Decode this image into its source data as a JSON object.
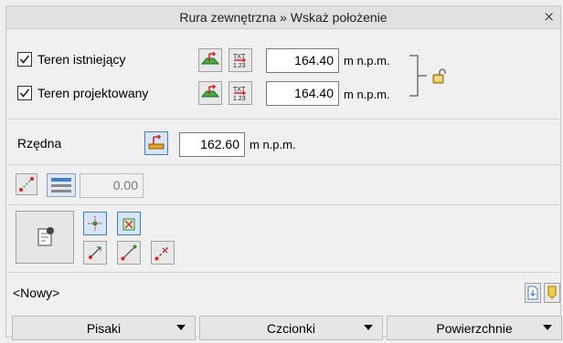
{
  "window": {
    "title": "Rura zewnętrzna » Wskaż położenie",
    "close_glyph": "×"
  },
  "terrain": {
    "existing": {
      "label": "Teren istniejący",
      "checked": true,
      "value": "164.40",
      "unit": "m n.p.m."
    },
    "designed": {
      "label": "Teren projektowany",
      "checked": true,
      "value": "164.40",
      "unit": "m n.p.m."
    },
    "txt_icon_top": "TXT",
    "txt_icon_bottom": "1.23"
  },
  "ordinate": {
    "label": "Rzędna",
    "value": "162.60",
    "unit": "m n.p.m."
  },
  "slope": {
    "value": "0.00"
  },
  "name_field": {
    "value": "<Nowy>"
  },
  "bottom_buttons": [
    {
      "label": "Pisaki"
    },
    {
      "label": "Czcionki"
    },
    {
      "label": "Powierzchnie"
    }
  ],
  "colors": {
    "accent_blue": "#3c7fd0",
    "check_green": "#2f8f2f",
    "arrow_red": "#d22"
  }
}
